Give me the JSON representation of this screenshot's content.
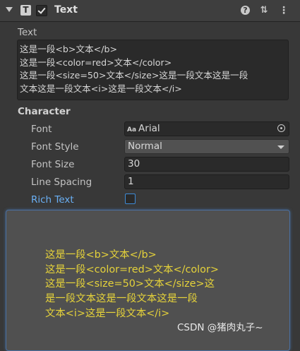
{
  "component": {
    "title": "Text",
    "icon": "text-component-icon",
    "enabled": true
  },
  "header_icons": [
    "help-icon",
    "preset-icon",
    "more-options-icon"
  ],
  "text_field": {
    "label": "Text",
    "value": "这是一段<b>文本</b>\n这是一段<color=red>文本</color>\n这是一段<size=50>文本</size>这是一段文本这是一段\n文本这是一段文本<i>这是一段文本</i>"
  },
  "character": {
    "heading": "Character",
    "font": {
      "label": "Font",
      "value": "Arial",
      "badge": "Aa"
    },
    "font_style": {
      "label": "Font Style",
      "value": "Normal"
    },
    "font_size": {
      "label": "Font Size",
      "value": "30"
    },
    "line_spacing": {
      "label": "Line Spacing",
      "value": "1"
    },
    "rich_text": {
      "label": "Rich Text",
      "checked": false
    }
  },
  "preview": {
    "text": "这是一段<b>文本</b>\n这是一段<color=red>文本</color>\n这是一段<size=50>文本</size>这\n是一段文本这是一段文本这是一段\n文本<i>这是一段文本</i>",
    "color": "#e5d23a"
  },
  "watermark": "CSDN @猪肉丸子~"
}
